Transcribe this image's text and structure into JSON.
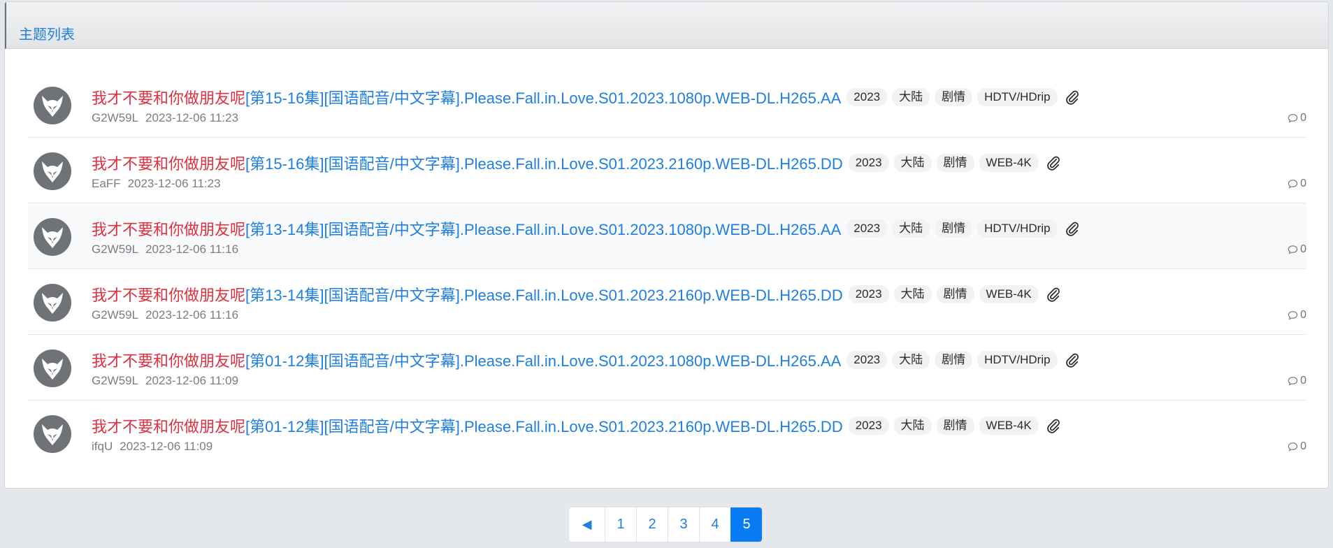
{
  "panel": {
    "title": "主题列表"
  },
  "threads": [
    {
      "title_red": "我才不要和你做朋友呢",
      "title_blue": "[第15-16集][国语配音/中文字幕].Please.Fall.in.Love.S01.2023.1080p.WEB-DL.H265.AA",
      "tags": [
        "2023",
        "大陆",
        "剧情",
        "HDTV/HDrip"
      ],
      "author": "G2W59L",
      "time": "2023-12-06 11:23",
      "comments": "0"
    },
    {
      "title_red": "我才不要和你做朋友呢",
      "title_blue": "[第15-16集][国语配音/中文字幕].Please.Fall.in.Love.S01.2023.2160p.WEB-DL.H265.DD",
      "tags": [
        "2023",
        "大陆",
        "剧情",
        "WEB-4K"
      ],
      "author": "EaFF",
      "time": "2023-12-06 11:23",
      "comments": "0"
    },
    {
      "title_red": "我才不要和你做朋友呢",
      "title_blue": "[第13-14集][国语配音/中文字幕].Please.Fall.in.Love.S01.2023.1080p.WEB-DL.H265.AA",
      "tags": [
        "2023",
        "大陆",
        "剧情",
        "HDTV/HDrip"
      ],
      "author": "G2W59L",
      "time": "2023-12-06 11:16",
      "comments": "0"
    },
    {
      "title_red": "我才不要和你做朋友呢",
      "title_blue": "[第13-14集][国语配音/中文字幕].Please.Fall.in.Love.S01.2023.2160p.WEB-DL.H265.DD",
      "tags": [
        "2023",
        "大陆",
        "剧情",
        "WEB-4K"
      ],
      "author": "G2W59L",
      "time": "2023-12-06 11:16",
      "comments": "0"
    },
    {
      "title_red": "我才不要和你做朋友呢",
      "title_blue": "[第01-12集][国语配音/中文字幕].Please.Fall.in.Love.S01.2023.1080p.WEB-DL.H265.AA",
      "tags": [
        "2023",
        "大陆",
        "剧情",
        "HDTV/HDrip"
      ],
      "author": "G2W59L",
      "time": "2023-12-06 11:09",
      "comments": "0"
    },
    {
      "title_red": "我才不要和你做朋友呢",
      "title_blue": "[第01-12集][国语配音/中文字幕].Please.Fall.in.Love.S01.2023.2160p.WEB-DL.H265.DD",
      "tags": [
        "2023",
        "大陆",
        "剧情",
        "WEB-4K"
      ],
      "author": "ifqU",
      "time": "2023-12-06 11:09",
      "comments": "0"
    }
  ],
  "pagination": {
    "prev": "◀",
    "pages": [
      "1",
      "2",
      "3",
      "4",
      "5"
    ],
    "current": "5"
  },
  "colors": {
    "title_red": "#e0303f",
    "link_blue": "#1f7fe0",
    "active_page": "#0a7cf3"
  }
}
